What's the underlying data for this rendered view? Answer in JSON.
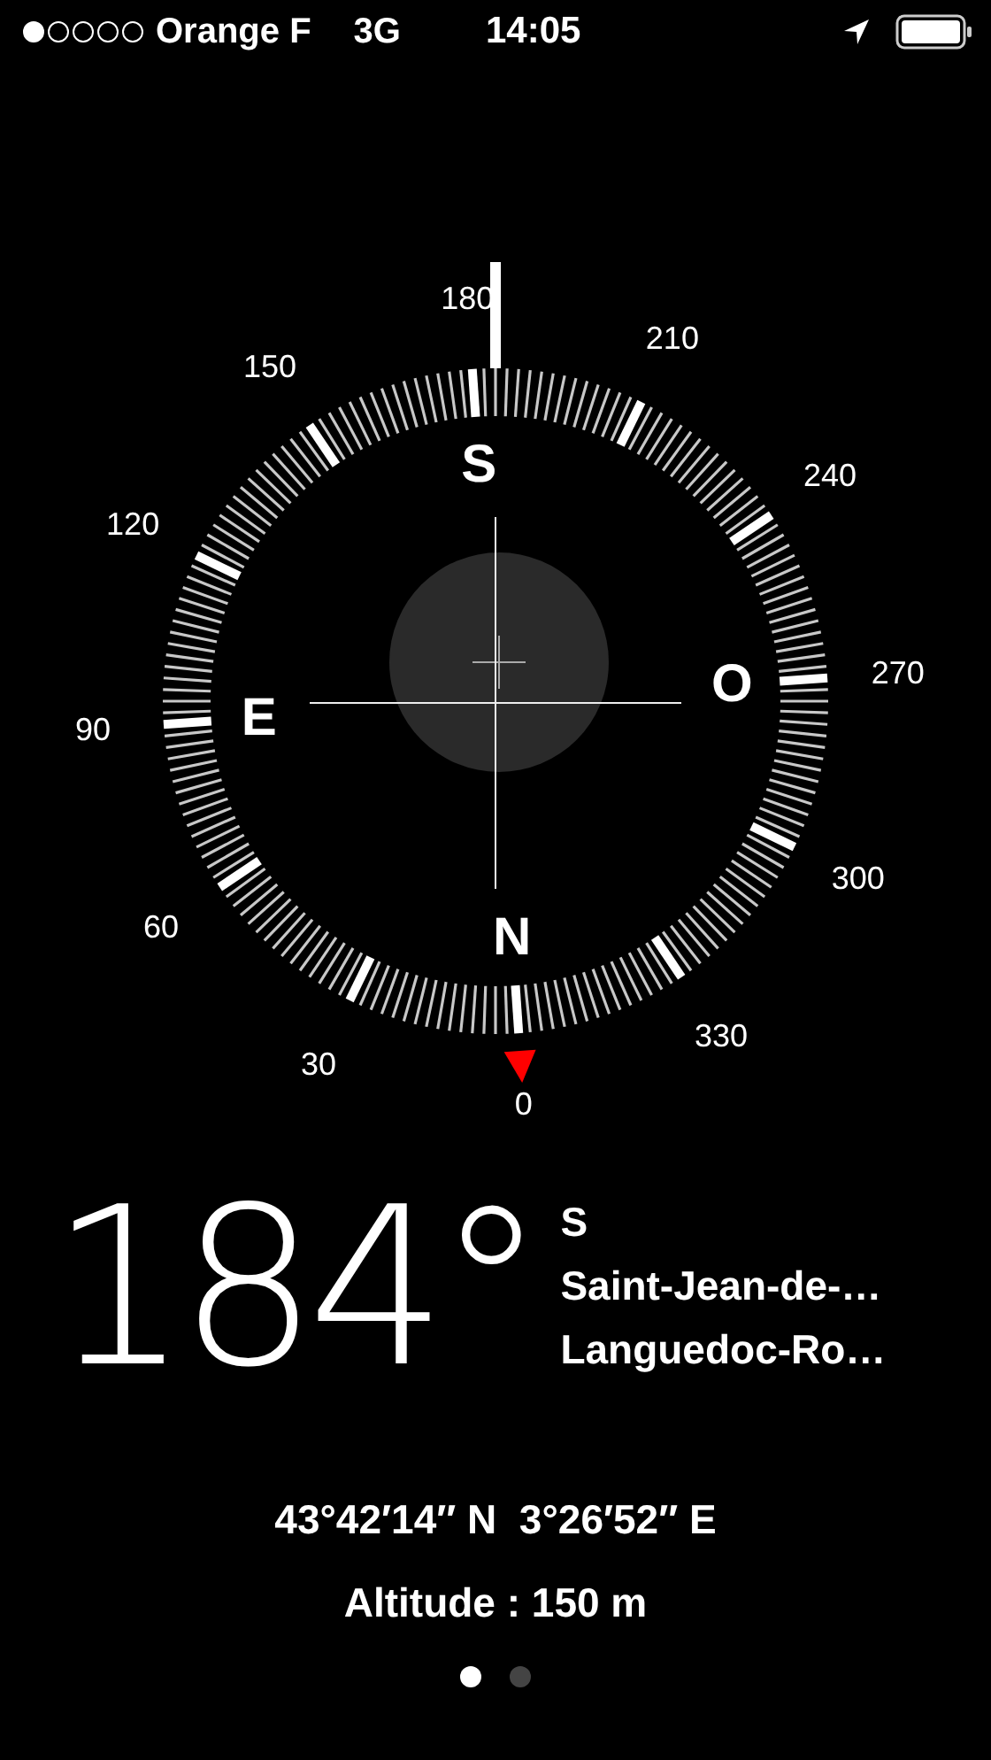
{
  "status_bar": {
    "carrier": "Orange F",
    "network": "3G",
    "time": "14:05"
  },
  "compass": {
    "degree_labels": [
      "0",
      "30",
      "60",
      "90",
      "120",
      "150",
      "180",
      "210",
      "240",
      "270",
      "300",
      "330"
    ],
    "cardinals": [
      "N",
      "E",
      "S",
      "O"
    ]
  },
  "reading": {
    "heading": "184°",
    "direction": "S",
    "place": "Saint-Jean-de-…",
    "region": "Languedoc-Ro…"
  },
  "coordinates": "43°42′14″ N  3°26′52″ E",
  "altitude": "Altitude : 150 m",
  "pages": [
    {
      "selected": true
    },
    {
      "selected": false
    }
  ]
}
